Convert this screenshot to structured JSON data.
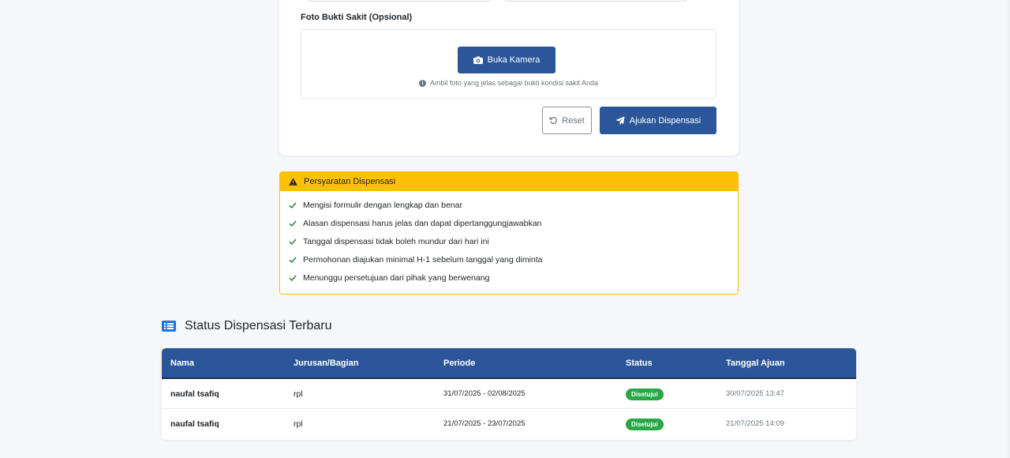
{
  "form": {
    "foto_label": "Foto Bukti Sakit (Opsional)",
    "camera_button": "Buka Kamera",
    "camera_hint": "Ambil foto yang jelas sebagai bukti kondisi sakit Anda",
    "reset_button": "Reset",
    "submit_button": "Ajukan Dispensasi"
  },
  "requirements": {
    "title": "Persyaratan Dispensasi",
    "items": [
      "Mengisi formulir dengan lengkap dan benar",
      "Alasan dispensasi harus jelas dan dapat dipertanggungjawabkan",
      "Tanggal dispensasi tidak boleh mundur dari hari ini",
      "Permohonan diajukan minimal H-1 sebelum tanggal yang diminta",
      "Menunggu persetujuan dari pihak yang berwenang"
    ]
  },
  "status_section": {
    "title": "Status Dispensasi Terbaru",
    "columns": [
      "Nama",
      "Jurusan/Bagian",
      "Periode",
      "Status",
      "Tanggal Ajuan"
    ],
    "rows": [
      {
        "nama": "naufal tsafiq",
        "jurusan": "rpl",
        "periode": "31/07/2025 - 02/08/2025",
        "status": "Disetujui",
        "tanggal": "30/07/2025 13:47"
      },
      {
        "nama": "naufal tsafiq",
        "jurusan": "rpl",
        "periode": "21/07/2025 - 23/07/2025",
        "status": "Disetujui",
        "tanggal": "21/07/2025 14:09"
      }
    ]
  },
  "colors": {
    "primary": "#2b579a",
    "warning": "#ffc107",
    "success": "#28a745"
  }
}
